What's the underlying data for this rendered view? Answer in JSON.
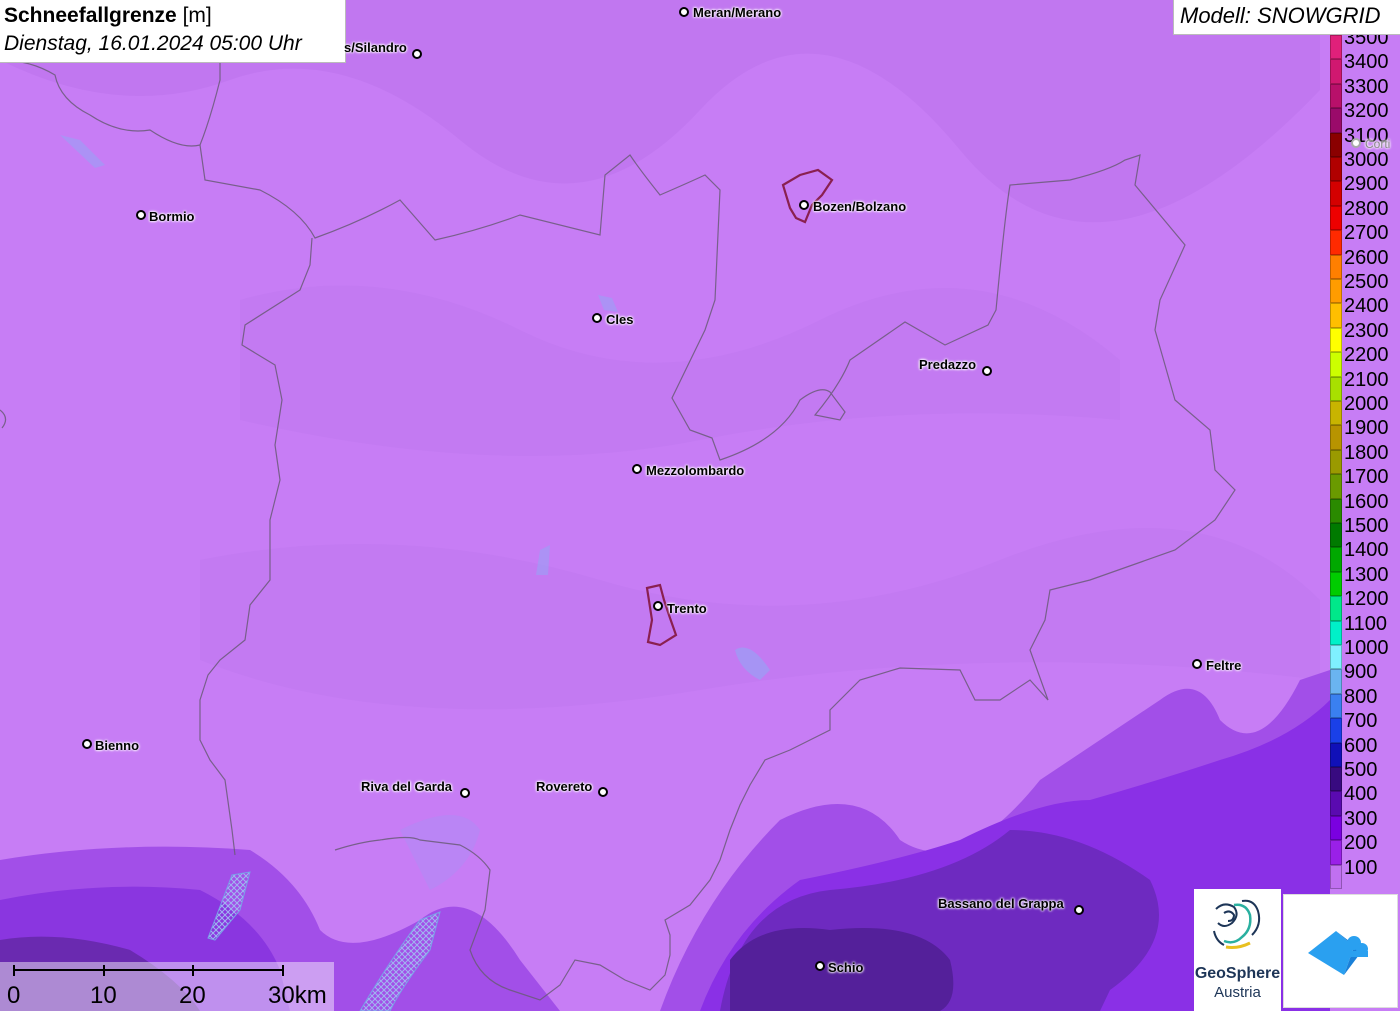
{
  "title": {
    "main": "Schneefallgrenze",
    "unit": "[m]",
    "date": "Dienstag, 16.01.2024 05:00 Uhr"
  },
  "model": "Modell: SNOWGRID",
  "legend": [
    {
      "label": "3500",
      "color": "#e0207a"
    },
    {
      "label": "3400",
      "color": "#d01870"
    },
    {
      "label": "3300",
      "color": "#b8106a"
    },
    {
      "label": "3200",
      "color": "#9a0a6a"
    },
    {
      "label": "3100",
      "color": "#8a0000"
    },
    {
      "label": "3000",
      "color": "#b00000"
    },
    {
      "label": "2900",
      "color": "#d40000"
    },
    {
      "label": "2800",
      "color": "#ee0000"
    },
    {
      "label": "2700",
      "color": "#ff2a00"
    },
    {
      "label": "2600",
      "color": "#ff7f00"
    },
    {
      "label": "2500",
      "color": "#ff9c00"
    },
    {
      "label": "2400",
      "color": "#ffbf00"
    },
    {
      "label": "2300",
      "color": "#ffff00"
    },
    {
      "label": "2200",
      "color": "#ccff00"
    },
    {
      "label": "2100",
      "color": "#a8e000"
    },
    {
      "label": "2000",
      "color": "#c8b400"
    },
    {
      "label": "1900",
      "color": "#b89400"
    },
    {
      "label": "1800",
      "color": "#9a9a00"
    },
    {
      "label": "1700",
      "color": "#6a9a00"
    },
    {
      "label": "1600",
      "color": "#2a8a00"
    },
    {
      "label": "1500",
      "color": "#007a00"
    },
    {
      "label": "1400",
      "color": "#00a800"
    },
    {
      "label": "1300",
      "color": "#00cc00"
    },
    {
      "label": "1200",
      "color": "#00e88a"
    },
    {
      "label": "1100",
      "color": "#00f0c8"
    },
    {
      "label": "1000",
      "color": "#7ff0ff"
    },
    {
      "label": "900",
      "color": "#6ab4f0"
    },
    {
      "label": "800",
      "color": "#3a80f0"
    },
    {
      "label": "700",
      "color": "#1a40e8"
    },
    {
      "label": "600",
      "color": "#1010b8"
    },
    {
      "label": "500",
      "color": "#380a80"
    },
    {
      "label": "400",
      "color": "#5a0ab0"
    },
    {
      "label": "300",
      "color": "#7a00e0"
    },
    {
      "label": "200",
      "color": "#9a20e8"
    },
    {
      "label": "100",
      "color": "#c070f0"
    }
  ],
  "cities": [
    {
      "name": "Meran/Merano"
    },
    {
      "name": "s/Silandro"
    },
    {
      "name": "Bormio"
    },
    {
      "name": "Bozen/Bolzano"
    },
    {
      "name": "Cles"
    },
    {
      "name": "Predazzo"
    },
    {
      "name": "Mezzolombardo"
    },
    {
      "name": "Trento"
    },
    {
      "name": "Feltre"
    },
    {
      "name": "Bienno"
    },
    {
      "name": "Riva del Garda"
    },
    {
      "name": "Rovereto"
    },
    {
      "name": "Bassano del Grappa"
    },
    {
      "name": "Schio"
    },
    {
      "name": "Corti"
    }
  ],
  "scale": {
    "labels": [
      "0",
      "10",
      "20",
      "30km"
    ]
  },
  "logos": {
    "geosphere_line1": "GeoSphere",
    "geosphere_line2": "Austria"
  }
}
